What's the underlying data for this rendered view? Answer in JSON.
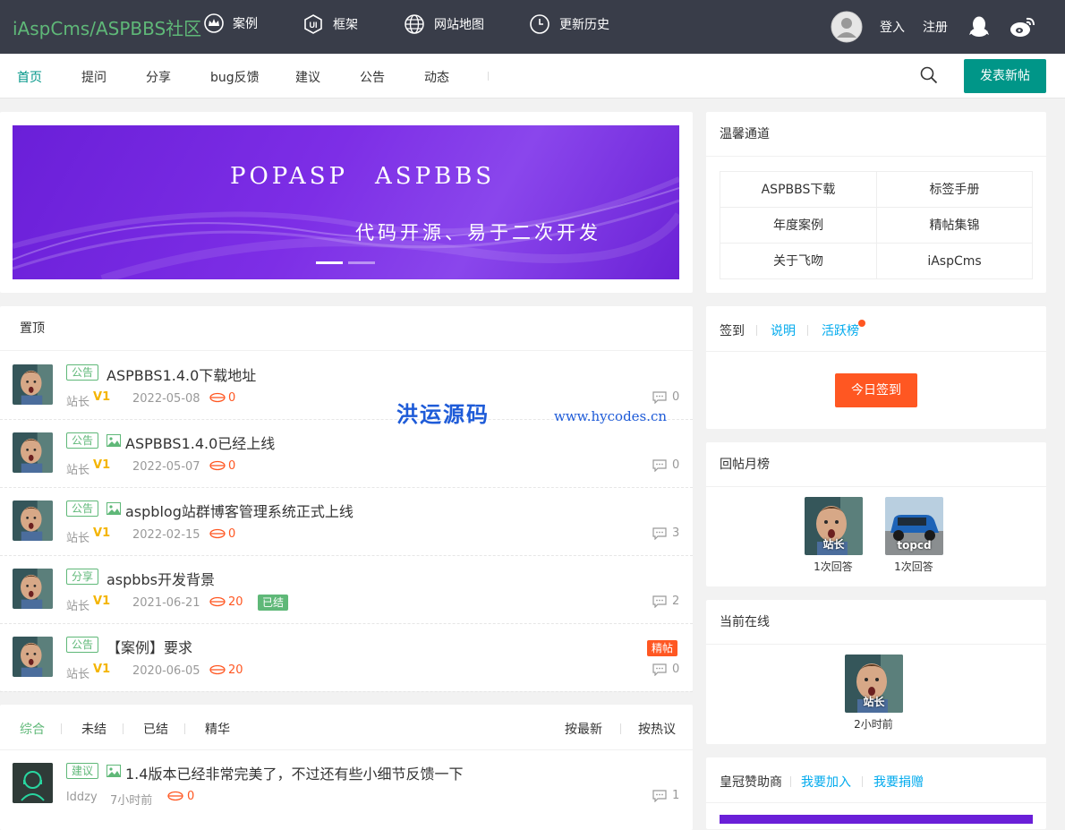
{
  "header": {
    "logo": "iAspCms/ASPBBS社区",
    "nav": [
      {
        "label": "案例",
        "icon": "crown-icon"
      },
      {
        "label": "框架",
        "icon": "ui-icon"
      },
      {
        "label": "网站地图",
        "icon": "globe-icon"
      },
      {
        "label": "更新历史",
        "icon": "clock-icon"
      }
    ],
    "login": "登入",
    "register": "注册",
    "qq_icon": "qq-icon",
    "weibo_icon": "weibo-icon"
  },
  "mainnav": {
    "items": [
      "首页",
      "提问",
      "分享",
      "bug反馈",
      "建议",
      "公告",
      "动态"
    ],
    "active": "首页",
    "post_button": "发表新帖"
  },
  "banner": {
    "title": "POPASP　ASPBBS",
    "subtitle": "代码开源、易于二次开发"
  },
  "sticky": {
    "heading": "置顶",
    "posts": [
      {
        "tag": "公告",
        "title": "ASPBBS1.4.0下载地址",
        "has_image": false,
        "author": "站长",
        "level": "1",
        "date": "2022-05-08",
        "reward": "0",
        "comments": "0",
        "badge": ""
      },
      {
        "tag": "公告",
        "title": "ASPBBS1.4.0已经上线",
        "has_image": true,
        "author": "站长",
        "level": "1",
        "date": "2022-05-07",
        "reward": "0",
        "comments": "0",
        "badge": ""
      },
      {
        "tag": "公告",
        "title": "aspblog站群博客管理系统正式上线",
        "has_image": true,
        "author": "站长",
        "level": "1",
        "date": "2022-02-15",
        "reward": "0",
        "comments": "3",
        "badge": ""
      },
      {
        "tag": "分享",
        "title": "aspbbs开发背景",
        "has_image": false,
        "author": "站长",
        "level": "1",
        "date": "2021-06-21",
        "reward": "20",
        "comments": "2",
        "badge": "已结"
      },
      {
        "tag": "公告",
        "title": "【案例】要求",
        "has_image": false,
        "author": "站长",
        "level": "1",
        "date": "2020-06-05",
        "reward": "20",
        "comments": "0",
        "badge": "精帖"
      }
    ]
  },
  "filters": {
    "tabs": [
      "综合",
      "未结",
      "已结",
      "精华"
    ],
    "active": "综合",
    "sort": [
      "按最新",
      "按热议"
    ]
  },
  "latest": {
    "tag": "建议",
    "title": "1.4版本已经非常完美了，不过还有些小细节反馈一下",
    "author": "lddzy",
    "time": "7小时前",
    "reward": "0",
    "comments": "1"
  },
  "quick": {
    "heading": "温馨通道",
    "links": [
      "ASPBBS下载",
      "标签手册",
      "年度案例",
      "精帖集锦",
      "关于飞吻",
      "iAspCms"
    ]
  },
  "signin": {
    "tab": "签到",
    "explain": "说明",
    "active_rank": "活跃榜",
    "button": "今日签到"
  },
  "reply_rank": {
    "heading": "回帖月榜",
    "users": [
      {
        "name": "站长",
        "count": "1次回答"
      },
      {
        "name": "topcd",
        "count": "1次回答"
      }
    ]
  },
  "online": {
    "heading": "当前在线",
    "user": "站长",
    "time": "2小时前"
  },
  "sponsor": {
    "heading": "皇冠赞助商",
    "join": "我要加入",
    "donate": "我要捐赠"
  },
  "watermark": {
    "cn": "洪运源码",
    "url": "www.hycodes.cn"
  },
  "colors": {
    "topbar": "#393d49",
    "accent": "#009688",
    "green": "#5fb878",
    "orange": "#ff5722",
    "link": "#01aaed",
    "banner": "#7d2ee6"
  }
}
